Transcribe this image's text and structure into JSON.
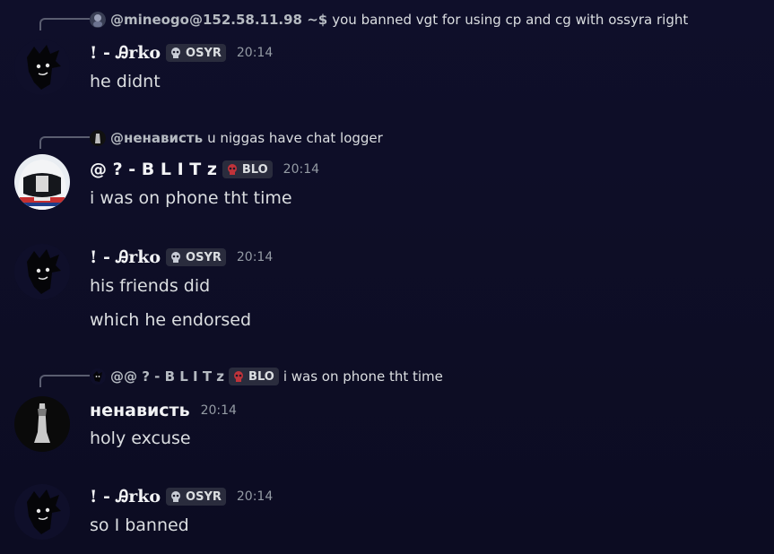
{
  "messages": [
    {
      "reply": {
        "name": "@mineogo@152.58.11.98 ~$",
        "text": "you banned vgt for using cp and cg with ossyra right"
      },
      "author": "! - Ꭿrko",
      "tag": "OSYR",
      "time": "20:14",
      "lines": [
        "he didnt"
      ]
    },
    {
      "reply": {
        "name": "@ненависть",
        "text": "u niggas have chat logger"
      },
      "author": "@ ? - B L I T z",
      "tag": "BLO",
      "time": "20:14",
      "lines": [
        "i was on phone tht time"
      ]
    },
    {
      "author": "! - Ꭿrko",
      "tag": "OSYR",
      "time": "20:14",
      "lines": [
        "his friends did",
        "which he endorsed"
      ]
    },
    {
      "reply": {
        "name": "@@ ? - B L I T z",
        "tag": "BLO",
        "text": "i was on phone tht time"
      },
      "author": "ненависть",
      "time": "20:14",
      "lines": [
        "holy excuse"
      ]
    },
    {
      "author": "! - Ꭿrko",
      "tag": "OSYR",
      "time": "20:14",
      "lines": [
        "so I banned"
      ]
    }
  ],
  "icons": {
    "osyr_tag": "skull-icon",
    "blo_tag": "skull-icon"
  }
}
